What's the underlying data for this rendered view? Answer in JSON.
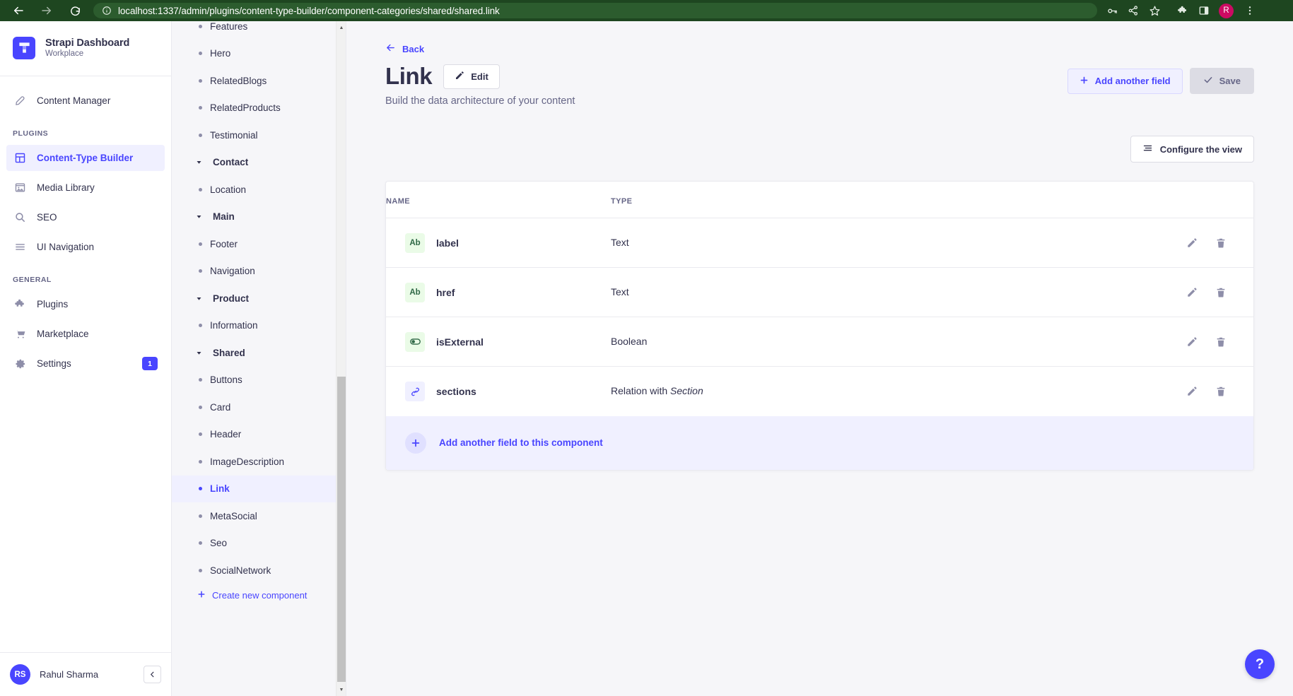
{
  "browser": {
    "url_prefix": "localhost",
    "url_rest": ":1337/admin/plugins/content-type-builder/component-categories/shared/shared.link",
    "back_icon": "back-arrow-icon",
    "forward_icon": "forward-arrow-icon",
    "reload_icon": "reload-icon",
    "info_icon": "site-info-icon",
    "toolbar_icons": [
      "password-key-icon",
      "share-icon",
      "bookmark-star-icon",
      "extensions-puzzle-icon",
      "side-panel-icon"
    ],
    "profile_initial": "R",
    "menu_icon": "three-dot-menu-icon"
  },
  "sidebar": {
    "brand": {
      "title": "Strapi Dashboard",
      "subtitle": "Workplace",
      "logo_icon": "strapi-logo-icon"
    },
    "top_items": [
      {
        "label": "Content Manager",
        "icon": "feather-pen-icon",
        "active": false
      }
    ],
    "sections": [
      {
        "label": "PLUGINS",
        "items": [
          {
            "label": "Content-Type Builder",
            "icon": "layout-grid-icon",
            "active": true
          },
          {
            "label": "Media Library",
            "icon": "image-icon",
            "active": false
          },
          {
            "label": "SEO",
            "icon": "search-icon",
            "active": false
          },
          {
            "label": "UI Navigation",
            "icon": "hamburger-lines-icon",
            "active": false
          }
        ]
      },
      {
        "label": "GENERAL",
        "items": [
          {
            "label": "Plugins",
            "icon": "puzzle-icon",
            "active": false
          },
          {
            "label": "Marketplace",
            "icon": "shopping-cart-icon",
            "active": false
          },
          {
            "label": "Settings",
            "icon": "gear-icon",
            "active": false,
            "badge": "1"
          }
        ]
      }
    ],
    "footer": {
      "initials": "RS",
      "name": "Rahul Sharma",
      "collapse_icon": "chevron-left-icon"
    }
  },
  "component_list": {
    "items": [
      {
        "label": "Features",
        "type": "item",
        "active": false
      },
      {
        "label": "Hero",
        "type": "item",
        "active": false
      },
      {
        "label": "RelatedBlogs",
        "type": "item",
        "active": false
      },
      {
        "label": "RelatedProducts",
        "type": "item",
        "active": false
      },
      {
        "label": "Testimonial",
        "type": "item",
        "active": false
      },
      {
        "label": "Contact",
        "type": "group",
        "active": false
      },
      {
        "label": "Location",
        "type": "item",
        "active": false
      },
      {
        "label": "Main",
        "type": "group",
        "active": false
      },
      {
        "label": "Footer",
        "type": "item",
        "active": false
      },
      {
        "label": "Navigation",
        "type": "item",
        "active": false
      },
      {
        "label": "Product",
        "type": "group",
        "active": false
      },
      {
        "label": "Information",
        "type": "item",
        "active": false
      },
      {
        "label": "Shared",
        "type": "group",
        "active": false
      },
      {
        "label": "Buttons",
        "type": "item",
        "active": false
      },
      {
        "label": "Card",
        "type": "item",
        "active": false
      },
      {
        "label": "Header",
        "type": "item",
        "active": false
      },
      {
        "label": "ImageDescription",
        "type": "item",
        "active": false
      },
      {
        "label": "Link",
        "type": "item",
        "active": true
      },
      {
        "label": "MetaSocial",
        "type": "item",
        "active": false
      },
      {
        "label": "Seo",
        "type": "item",
        "active": false
      },
      {
        "label": "SocialNetwork",
        "type": "item",
        "active": false
      }
    ],
    "create_new_label": "Create new component",
    "create_new_icon": "plus-icon"
  },
  "main": {
    "back_label": "Back",
    "back_icon": "arrow-left-icon",
    "title": "Link",
    "edit_label": "Edit",
    "edit_icon": "pencil-icon",
    "subtitle": "Build the data architecture of your content",
    "add_field_label": "Add another field",
    "add_field_icon": "plus-icon",
    "save_label": "Save",
    "save_icon": "check-icon",
    "configure_label": "Configure the view",
    "configure_icon": "sliders-icon",
    "table": {
      "headers": {
        "name": "NAME",
        "type": "TYPE"
      },
      "rows": [
        {
          "name": "label",
          "type": "Text",
          "type_italic": "",
          "icon": "text-ab-icon",
          "icon_text": "Ab",
          "icon_color": "green"
        },
        {
          "name": "href",
          "type": "Text",
          "type_italic": "",
          "icon": "text-ab-icon",
          "icon_text": "Ab",
          "icon_color": "green"
        },
        {
          "name": "isExternal",
          "type": "Boolean",
          "type_italic": "",
          "icon": "toggle-switch-icon",
          "icon_text": "",
          "icon_color": "green"
        },
        {
          "name": "sections",
          "type": "Relation with ",
          "type_italic": "Section",
          "icon": "relation-link-icon",
          "icon_text": "",
          "icon_color": "blue"
        }
      ],
      "edit_icon": "pencil-icon",
      "delete_icon": "trash-icon"
    },
    "add_field_component_label": "Add another field to this component",
    "add_field_component_icon": "plus-icon",
    "help_label": "?",
    "help_icon": "question-mark-icon"
  },
  "colors": {
    "brand_purple": "#4945ff",
    "browser_green": "#1e4620",
    "profile_pink": "#cc0a62",
    "green_badge": "#eafbe7",
    "page_bg": "#f6f6f9"
  }
}
